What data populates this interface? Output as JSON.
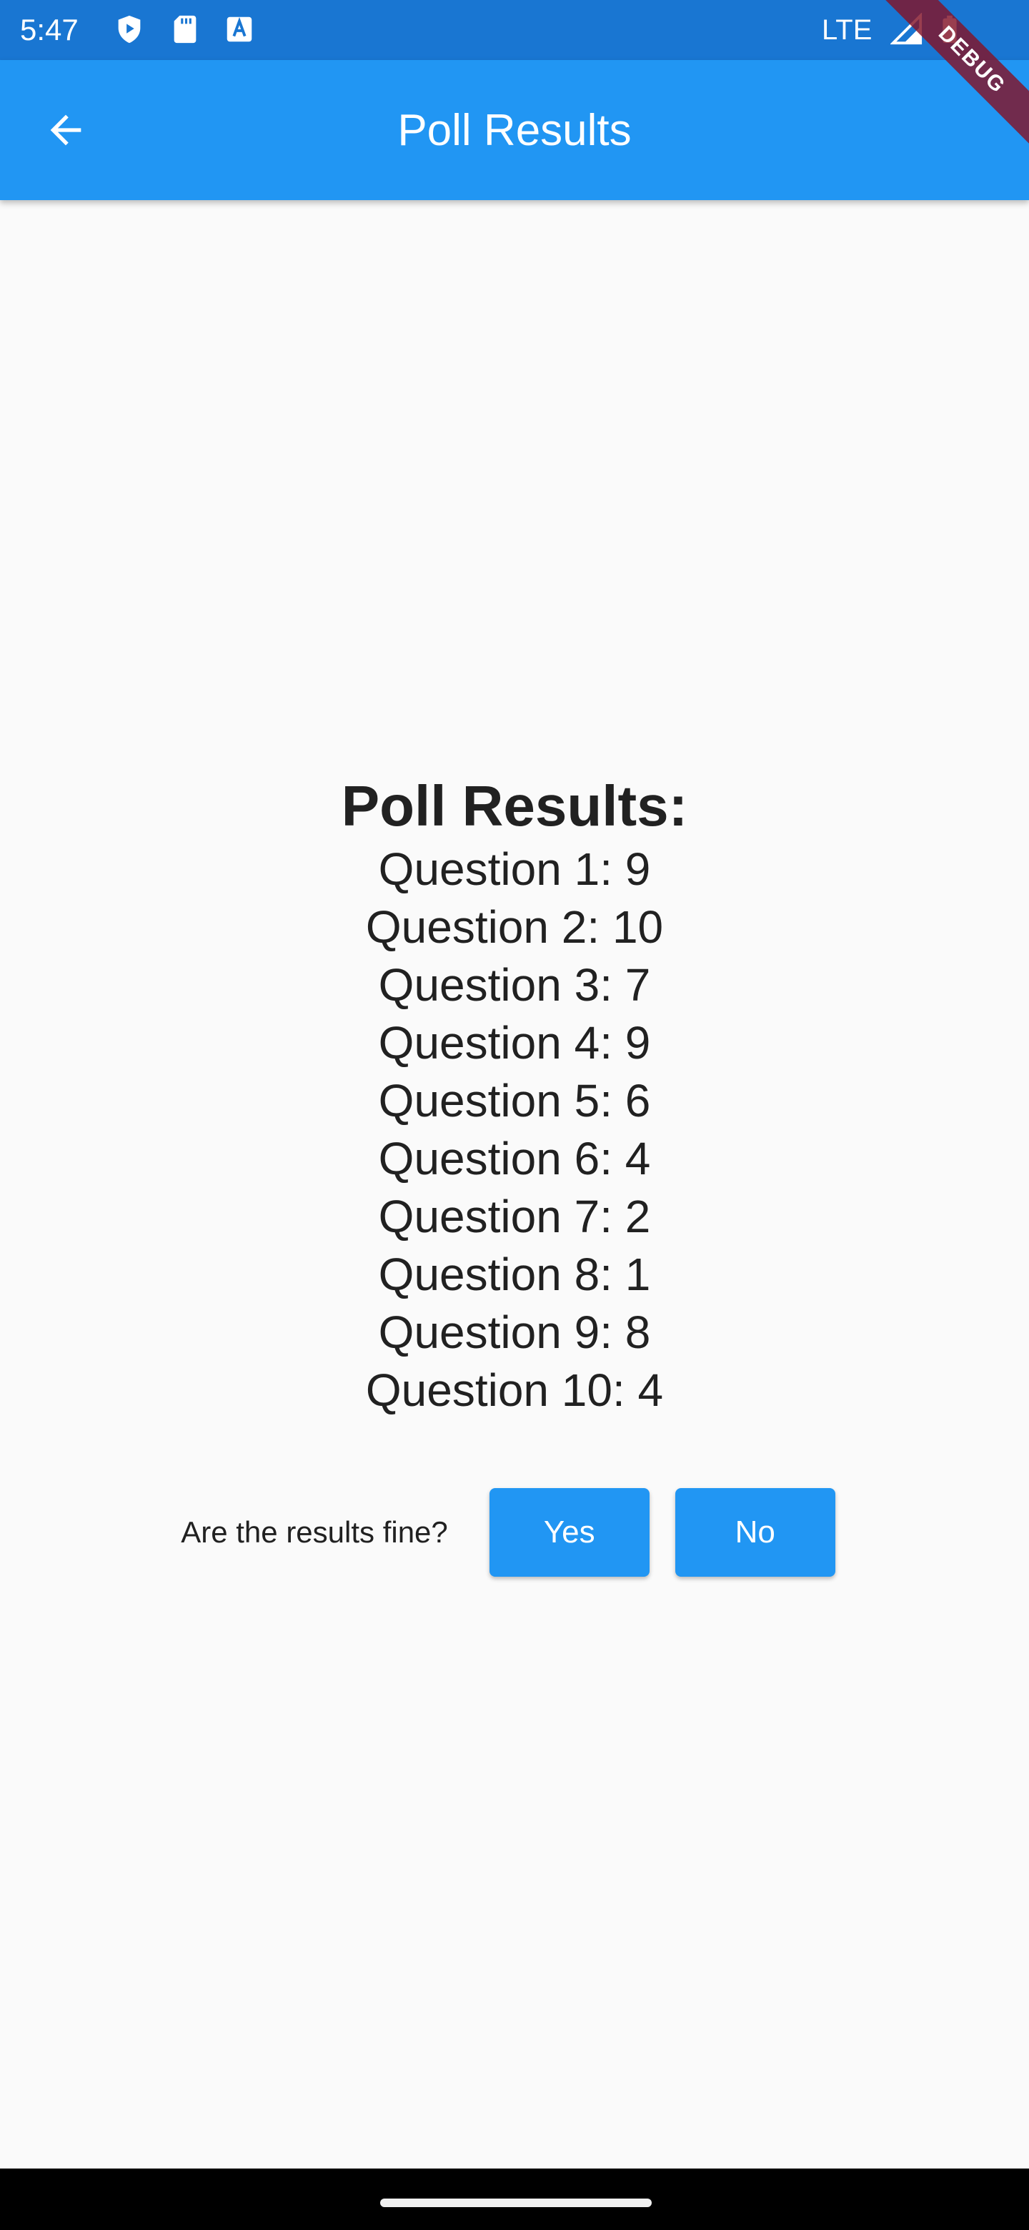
{
  "status_bar": {
    "time": "5:47",
    "network": "LTE",
    "icons": [
      "play-protect-icon",
      "sd-card-icon",
      "font-a-icon",
      "signal-icon",
      "battery-icon"
    ]
  },
  "app_bar": {
    "title": "Poll Results",
    "back_icon": "arrow-back-icon"
  },
  "debug_banner": "DEBUG",
  "poll": {
    "heading": "Poll Results:",
    "results": [
      "Question 1: 9",
      "Question 2: 10",
      "Question 3: 7",
      "Question 4: 9",
      "Question 5: 6",
      "Question 6: 4",
      "Question 7: 2",
      "Question 8: 1",
      "Question 9: 8",
      "Question 10: 4"
    ]
  },
  "confirm": {
    "question": "Are the results fine?",
    "yes_label": "Yes",
    "no_label": "No"
  },
  "colors": {
    "app_bar": "#2196f3",
    "status_bar": "#1976d2",
    "background": "#fafafa"
  }
}
